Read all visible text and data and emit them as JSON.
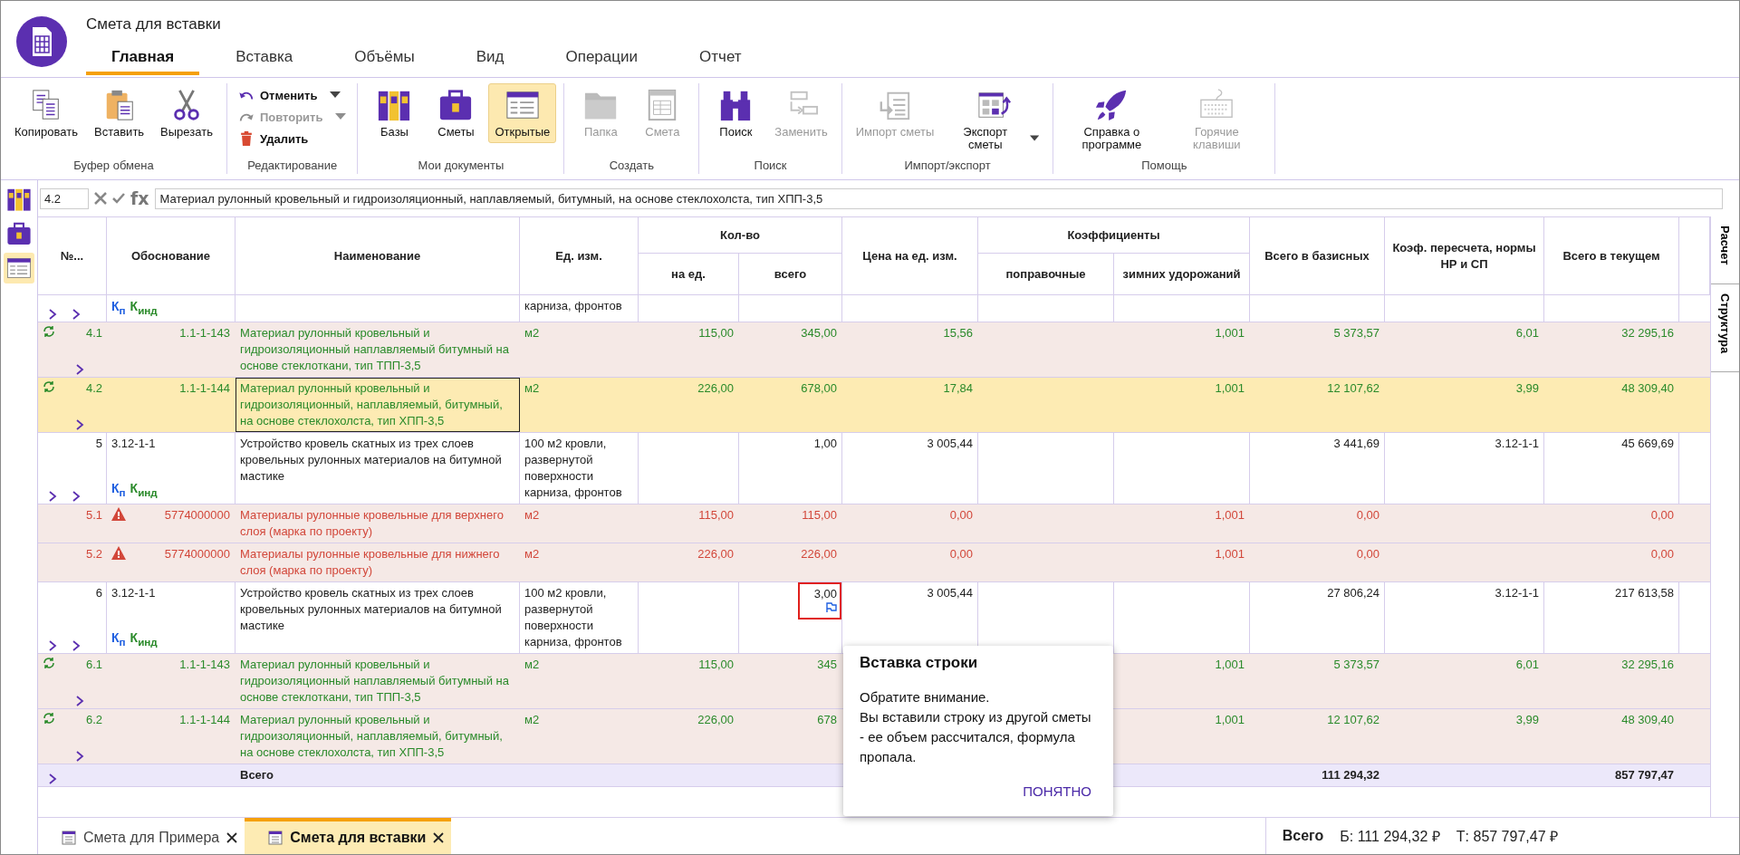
{
  "app": {
    "title": "Смета для вставки"
  },
  "menu_tabs": [
    {
      "label": "Главная",
      "selected": true
    },
    {
      "label": "Вставка",
      "selected": false
    },
    {
      "label": "Объёмы",
      "selected": false
    },
    {
      "label": "Вид",
      "selected": false
    },
    {
      "label": "Операции",
      "selected": false
    },
    {
      "label": "Отчет",
      "selected": false
    }
  ],
  "ribbon": [
    {
      "label": "Буфер обмена",
      "buttons": [
        {
          "label": "Копировать",
          "kind": "copy",
          "disabled": false,
          "selected": false,
          "dropdown": false
        },
        {
          "label": "Вставить",
          "kind": "paste",
          "disabled": false,
          "selected": false,
          "dropdown": false
        },
        {
          "label": "Вырезать",
          "kind": "cut",
          "disabled": false,
          "selected": false,
          "dropdown": false
        }
      ]
    },
    {
      "label": "Редактирование",
      "buttons": [
        {
          "label": "Отменить",
          "kind": "undo",
          "disabled": false,
          "selected": false,
          "dropdown": true
        },
        {
          "label": "Повторить",
          "kind": "redo",
          "disabled": true,
          "selected": false,
          "dropdown": true
        },
        {
          "label": "Удалить",
          "kind": "delete",
          "disabled": false,
          "selected": false,
          "dropdown": false
        }
      ]
    },
    {
      "label": "Мои документы",
      "buttons": [
        {
          "label": "Базы",
          "kind": "books",
          "disabled": false,
          "selected": false,
          "dropdown": false
        },
        {
          "label": "Сметы",
          "kind": "briefcase",
          "disabled": false,
          "selected": false,
          "dropdown": false
        },
        {
          "label": "Открытые",
          "kind": "list",
          "disabled": false,
          "selected": true,
          "dropdown": false
        }
      ]
    },
    {
      "label": "Создать",
      "buttons": [
        {
          "label": "Папка",
          "kind": "folder",
          "disabled": true,
          "selected": false,
          "dropdown": false
        },
        {
          "label": "Смета",
          "kind": "sheet",
          "disabled": true,
          "selected": false,
          "dropdown": false
        }
      ]
    },
    {
      "label": "Поиск",
      "buttons": [
        {
          "label": "Поиск",
          "kind": "search",
          "disabled": false,
          "selected": false,
          "dropdown": false
        },
        {
          "label": "Заменить",
          "kind": "replace",
          "disabled": true,
          "selected": false,
          "dropdown": false
        }
      ]
    },
    {
      "label": "Импорт/экспорт",
      "buttons": [
        {
          "label": "Импорт сметы",
          "kind": "import",
          "disabled": true,
          "selected": false,
          "dropdown": false
        },
        {
          "label": "Экспорт сметы",
          "kind": "export",
          "disabled": false,
          "selected": false,
          "dropdown": true
        }
      ]
    },
    {
      "label": "Помощь",
      "buttons": [
        {
          "label": "Справка о программе",
          "kind": "rocket",
          "disabled": false,
          "selected": false,
          "dropdown": false
        },
        {
          "label": "Горячие клавиши",
          "kind": "keyboard",
          "disabled": true,
          "selected": false,
          "dropdown": false
        }
      ]
    }
  ],
  "side_panel": [
    {
      "kind": "books",
      "selected": false
    },
    {
      "kind": "briefcase",
      "selected": false
    },
    {
      "kind": "list",
      "selected": true
    }
  ],
  "formula_bar": {
    "cell": "4.2",
    "fx": "fx",
    "value": "Материал рулонный кровельный и гидроизоляционный, наплавляемый, битумный, на основе стеклохолста, тип ХПП-3,5"
  },
  "table": {
    "header": [
      {
        "label": "№..."
      },
      {
        "label": "Обоснование"
      },
      {
        "label": "Наименование"
      },
      {
        "label": "Ед. изм."
      },
      {
        "label": "Кол-во",
        "children": [
          {
            "label": "на ед."
          },
          {
            "label": "всего"
          }
        ]
      },
      {
        "label": "Цена на ед. изм."
      },
      {
        "label": "Коэффициенты",
        "children": [
          {
            "label": "поправочные"
          },
          {
            "label": "зимних удорожаний"
          }
        ]
      },
      {
        "label": "Всего в базисных"
      },
      {
        "label": "Коэф. пересчета, нормы НР и СП"
      },
      {
        "label": "Всего в текущем"
      }
    ],
    "rows": [
      {
        "kind": "work",
        "selected": false,
        "flagged": false,
        "markers": [
          {
            "text": "К$_{п}$",
            "color": "#1f5fe0"
          },
          {
            "text": "К$_{инд}$",
            "color": "#2a8a2a"
          }
        ],
        "unit": "карниза, фронтов"
      },
      {
        "kind": "material",
        "selected": false,
        "flagged": false,
        "num": "4.1",
        "basis": "1.1-1-143",
        "name": "Материал рулонный кровельный и гидроизоляционный наплавляемый битумный на основе стеклоткани, тип ТПП-3,5",
        "unit": "м2",
        "qty_per": "115,00",
        "qty_total": "345,00",
        "price": "15,56",
        "coef_winter": "1,001",
        "total_base": "5 373,57",
        "coef_recalc": "6,01",
        "total_current": "32 295,16"
      },
      {
        "kind": "material",
        "selected": true,
        "flagged": false,
        "num": "4.2",
        "basis": "1.1-1-144",
        "name": "Материал рулонный кровельный и гидроизоляционный, наплавляемый, битумный, на основе стеклохолста, тип ХПП-3,5",
        "unit": "м2",
        "qty_per": "226,00",
        "qty_total": "678,00",
        "price": "17,84",
        "coef_winter": "1,001",
        "total_base": "12 107,62",
        "coef_recalc": "3,99",
        "total_current": "48 309,40"
      },
      {
        "kind": "work",
        "selected": false,
        "flagged": false,
        "num": "5",
        "basis": "3.12-1-1",
        "markers": [
          {
            "text": "К$_{п}$",
            "color": "#1f5fe0"
          },
          {
            "text": "К$_{инд}$",
            "color": "#2a8a2a"
          }
        ],
        "name": "Устройство кровель скатных из трех слоев кровельных рулонных материалов на битумной мастике",
        "unit": "100 м2 кровли, развернутой поверхности карниза, фронтов",
        "qty_total": "1,00",
        "price": "3 005,44",
        "total_base": "3 441,69",
        "coef_recalc": "3.12-1-1",
        "total_current": "45 669,69"
      },
      {
        "kind": "warning",
        "selected": false,
        "flagged": false,
        "num": "5.1",
        "basis": "5774000000",
        "name": "Материалы рулонные кровельные для верхнего слоя (марка по проекту)",
        "unit": "м2",
        "qty_per": "115,00",
        "qty_total": "115,00",
        "price": "0,00",
        "coef_winter": "1,001",
        "total_base": "0,00",
        "total_current": "0,00"
      },
      {
        "kind": "warning",
        "selected": false,
        "flagged": false,
        "num": "5.2",
        "basis": "5774000000",
        "name": "Материалы рулонные кровельные для нижнего слоя (марка по проекту)",
        "unit": "м2",
        "qty_per": "226,00",
        "qty_total": "226,00",
        "price": "0,00",
        "coef_winter": "1,001",
        "total_base": "0,00",
        "total_current": "0,00"
      },
      {
        "kind": "work",
        "selected": false,
        "flagged": true,
        "num": "6",
        "basis": "3.12-1-1",
        "markers": [
          {
            "text": "К$_{п}$",
            "color": "#1f5fe0"
          },
          {
            "text": "К$_{инд}$",
            "color": "#2a8a2a"
          }
        ],
        "name": "Устройство кровель скатных из трех слоев кровельных рулонных материалов на битумной мастике",
        "unit": "100 м2 кровли, развернутой поверхности карниза, фронтов",
        "qty_total": "3,00",
        "price": "3 005,44",
        "total_base": "27 806,24",
        "coef_recalc": "3.12-1-1",
        "total_current": "217 613,58"
      },
      {
        "kind": "material",
        "selected": false,
        "flagged": false,
        "num": "6.1",
        "basis": "1.1-1-143",
        "name": "Материал рулонный кровельный и гидроизоляционный наплавляемый битумный на основе стеклоткани, тип ТПП-3,5",
        "unit": "м2",
        "qty_per": "115,00",
        "qty_total": "345",
        "coef_winter": "1,001",
        "total_base": "5 373,57",
        "coef_recalc": "6,01",
        "total_current": "32 295,16"
      },
      {
        "kind": "material",
        "selected": false,
        "flagged": false,
        "num": "6.2",
        "basis": "1.1-1-144",
        "name": "Материал рулонный кровельный и гидроизоляционный, наплавляемый, битумный, на основе стеклохолста, тип ХПП-3,5",
        "unit": "м2",
        "qty_per": "226,00",
        "qty_total": "678",
        "coef_winter": "1,001",
        "total_base": "12 107,62",
        "coef_recalc": "3,99",
        "total_current": "48 309,40"
      },
      {
        "kind": "total",
        "selected": false,
        "flagged": false,
        "name": "Всего",
        "total_base": "111 294,32",
        "total_current": "857 797,47"
      }
    ]
  },
  "popup": {
    "title": "Вставка строки",
    "lines": [
      "Обратите внимание.",
      "Вы вставили строку из другой сметы - ее объем рассчитался, формула пропала."
    ],
    "button": "ПОНЯТНО"
  },
  "side_tabs": [
    {
      "label": "Расчет"
    },
    {
      "label": "Структура"
    }
  ],
  "doc_tabs": [
    {
      "label": "Смета для Примера",
      "selected": false
    },
    {
      "label": "Смета для вставки",
      "selected": true
    }
  ],
  "status": {
    "label": "Всего",
    "base": "Б: 111 294,32 ₽",
    "current": "Т: 857 797,47 ₽"
  }
}
